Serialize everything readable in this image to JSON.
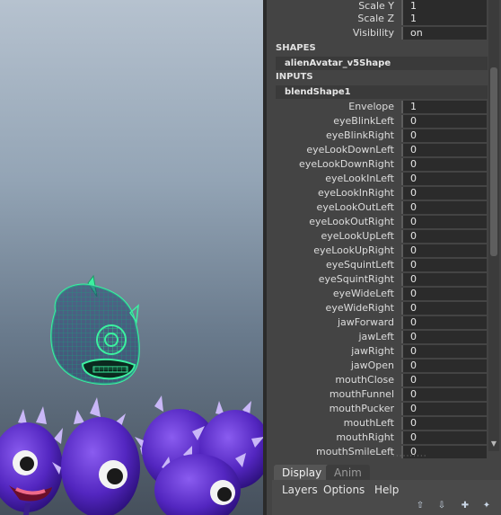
{
  "channel_box": {
    "top_attributes": [
      {
        "label": "Scale Y",
        "value": "1"
      },
      {
        "label": "Scale Z",
        "value": "1"
      },
      {
        "label": "Visibility",
        "value": "on"
      }
    ],
    "shapes_header": "SHAPES",
    "shape_node": "alienAvatar_v5Shape",
    "inputs_header": "INPUTS",
    "input_node": "blendShape1",
    "blendshape_attributes": [
      {
        "label": "Envelope",
        "value": "1"
      },
      {
        "label": "eyeBlinkLeft",
        "value": "0"
      },
      {
        "label": "eyeBlinkRight",
        "value": "0"
      },
      {
        "label": "eyeLookDownLeft",
        "value": "0"
      },
      {
        "label": "eyeLookDownRight",
        "value": "0"
      },
      {
        "label": "eyeLookInLeft",
        "value": "0"
      },
      {
        "label": "eyeLookInRight",
        "value": "0"
      },
      {
        "label": "eyeLookOutLeft",
        "value": "0"
      },
      {
        "label": "eyeLookOutRight",
        "value": "0"
      },
      {
        "label": "eyeLookUpLeft",
        "value": "0"
      },
      {
        "label": "eyeLookUpRight",
        "value": "0"
      },
      {
        "label": "eyeSquintLeft",
        "value": "0"
      },
      {
        "label": "eyeSquintRight",
        "value": "0"
      },
      {
        "label": "eyeWideLeft",
        "value": "0"
      },
      {
        "label": "eyeWideRight",
        "value": "0"
      },
      {
        "label": "jawForward",
        "value": "0"
      },
      {
        "label": "jawLeft",
        "value": "0"
      },
      {
        "label": "jawRight",
        "value": "0"
      },
      {
        "label": "jawOpen",
        "value": "0"
      },
      {
        "label": "mouthClose",
        "value": "0"
      },
      {
        "label": "mouthFunnel",
        "value": "0"
      },
      {
        "label": "mouthPucker",
        "value": "0"
      },
      {
        "label": "mouthLeft",
        "value": "0"
      },
      {
        "label": "mouthRight",
        "value": "0"
      },
      {
        "label": "mouthSmileLeft",
        "value": "0"
      }
    ]
  },
  "layer_editor": {
    "tabs": [
      "Display",
      "Anim"
    ],
    "active_tab": "Display",
    "menus": [
      "Layers",
      "Options",
      "Help"
    ],
    "buttons": [
      "move-layer-up-icon",
      "move-layer-down-icon",
      "new-layer-icon",
      "new-layer-from-selected-icon"
    ]
  },
  "colors": {
    "wireframe": "#3cf0a0",
    "alien_body": "#5a2fc4",
    "panel_bg": "#444444",
    "field_bg": "#2b2b2b"
  }
}
